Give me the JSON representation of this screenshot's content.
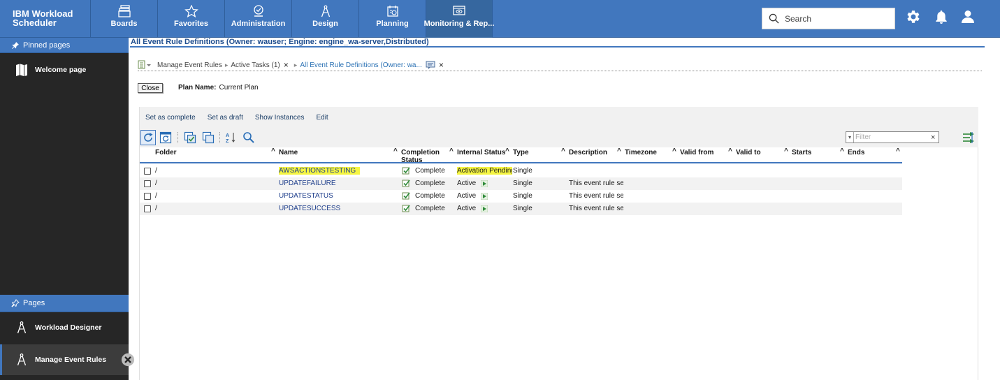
{
  "app": {
    "title": "IBM Workload Scheduler"
  },
  "nav": [
    {
      "label": "Boards",
      "icon": "boards-icon"
    },
    {
      "label": "Favorites",
      "icon": "star-icon"
    },
    {
      "label": "Administration",
      "icon": "admin-icon"
    },
    {
      "label": "Design",
      "icon": "compass-icon"
    },
    {
      "label": "Planning",
      "icon": "planning-icon"
    },
    {
      "label": "Monitoring & Rep...",
      "icon": "monitor-icon"
    }
  ],
  "search": {
    "placeholder": "Search"
  },
  "sidebar": {
    "pinned_header": "Pinned pages",
    "pinned_items": [
      {
        "label": "Welcome page",
        "icon": "book-icon"
      }
    ],
    "pages_header": "Pages",
    "page_items": [
      {
        "label": "Workload Designer",
        "icon": "compass-icon"
      },
      {
        "label": "Manage Event Rules",
        "icon": "compass-icon"
      }
    ]
  },
  "main": {
    "title": "All Event Rule Definitions (Owner: wauser; Engine: engine_wa-server,Distributed)",
    "breadcrumb": {
      "items": [
        "Manage Event Rules",
        "Active Tasks (1)",
        "All Event Rule Definitions (Owner: wa..."
      ],
      "close_glyph": "×"
    },
    "close_label": "Close",
    "plan_name_label": "Plan Name:",
    "plan_name_value": "Current Plan"
  },
  "actions": [
    "Set as complete",
    "Set as draft",
    "Show Instances",
    "Edit"
  ],
  "filter": {
    "placeholder": "Filter",
    "dropdown_glyph": "▾",
    "clear_glyph": "×"
  },
  "sort_glyph": "^",
  "table": {
    "columns": [
      "Folder",
      "Name",
      "Completion Status",
      "Internal Status",
      "Type",
      "Description",
      "Timezone",
      "Valid from",
      "Valid to",
      "Starts",
      "Ends"
    ],
    "rows": [
      {
        "folder": "/",
        "name": "AWSACTIONSTESTING",
        "completion": "Complete",
        "internal": "Activation Pending",
        "type": "Single",
        "description": "",
        "highlighted": true
      },
      {
        "folder": "/",
        "name": "UPDATEFAILURE",
        "completion": "Complete",
        "internal": "Active",
        "type": "Single",
        "description": "This event rule ser",
        "highlighted": false
      },
      {
        "folder": "/",
        "name": "UPDATESTATUS",
        "completion": "Complete",
        "internal": "Active",
        "type": "Single",
        "description": "This event rule ser",
        "highlighted": false
      },
      {
        "folder": "/",
        "name": "UPDATESUCCESS",
        "completion": "Complete",
        "internal": "Active",
        "type": "Single",
        "description": "This event rule ser",
        "highlighted": false
      }
    ]
  },
  "colors": {
    "brand": "#4177be",
    "sidebar": "#262626",
    "highlight": "#f5f542",
    "link": "#1f3f8c"
  }
}
